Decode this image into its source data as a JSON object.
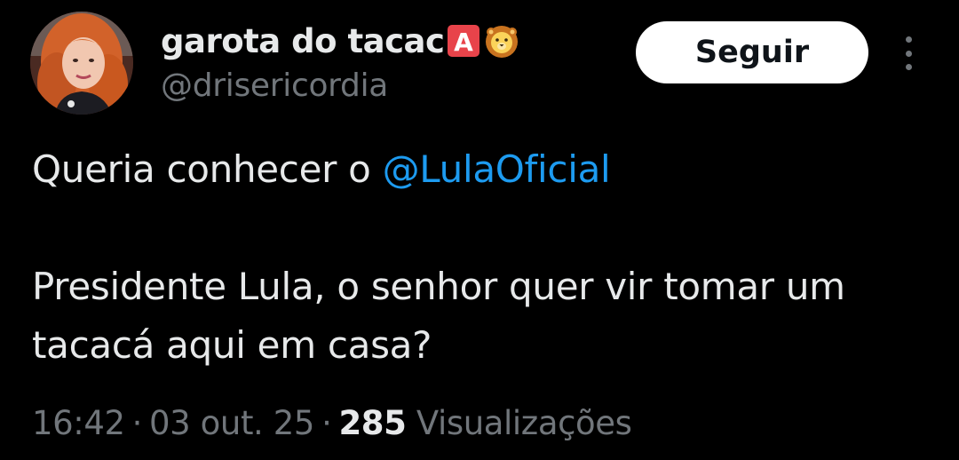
{
  "author": {
    "display_name": "garota do tacac",
    "badges": [
      "squared-a-emoji",
      "lion-face-emoji"
    ],
    "handle": "@drisericordia",
    "avatar": "profile-photo"
  },
  "header": {
    "follow_label": "Seguir",
    "more_icon": "more-vertical-icon"
  },
  "tweet": {
    "line1_prefix": "Queria conhecer o ",
    "mention": "@LulaOficial",
    "paragraph2": "Presidente Lula, o senhor quer vir tomar um tacacá aqui em casa?"
  },
  "meta": {
    "time": "16:42",
    "separator": "·",
    "date": "03 out. 25",
    "views_count": "285",
    "views_label": "Visualizações"
  },
  "colors": {
    "background": "#000000",
    "text": "#e7e9ea",
    "secondary_text": "#71767b",
    "link": "#1d9bf0",
    "button_bg": "#ffffff"
  }
}
